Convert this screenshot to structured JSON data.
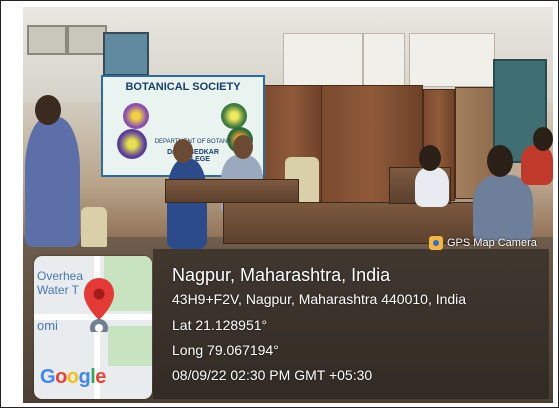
{
  "banner": {
    "title": "BOTANICAL SOCIETY",
    "dept_line": "DEPARTMENT OF BOTANY",
    "college_line": "Dr. AMBEDKAR COLLEGE"
  },
  "gps_camera": {
    "badge_label": "GPS Map Camera",
    "location": "Nagpur, Maharashtra, India",
    "address": "43H9+F2V, Nagpur, Maharashtra 440010, India",
    "latitude": "Lat 21.128951°",
    "longitude": "Long 79.067194°",
    "datetime": "08/09/22 02:30 PM GMT +05:30"
  },
  "map_thumbnail": {
    "label_overhead": "Overhea",
    "label_water": "Water T",
    "label_omi": "omi",
    "brand": "Google",
    "pin_color": "#e53935"
  },
  "google_colors": [
    "#4285F4",
    "#EA4335",
    "#FBBC05",
    "#4285F4",
    "#34A853",
    "#EA4335"
  ]
}
